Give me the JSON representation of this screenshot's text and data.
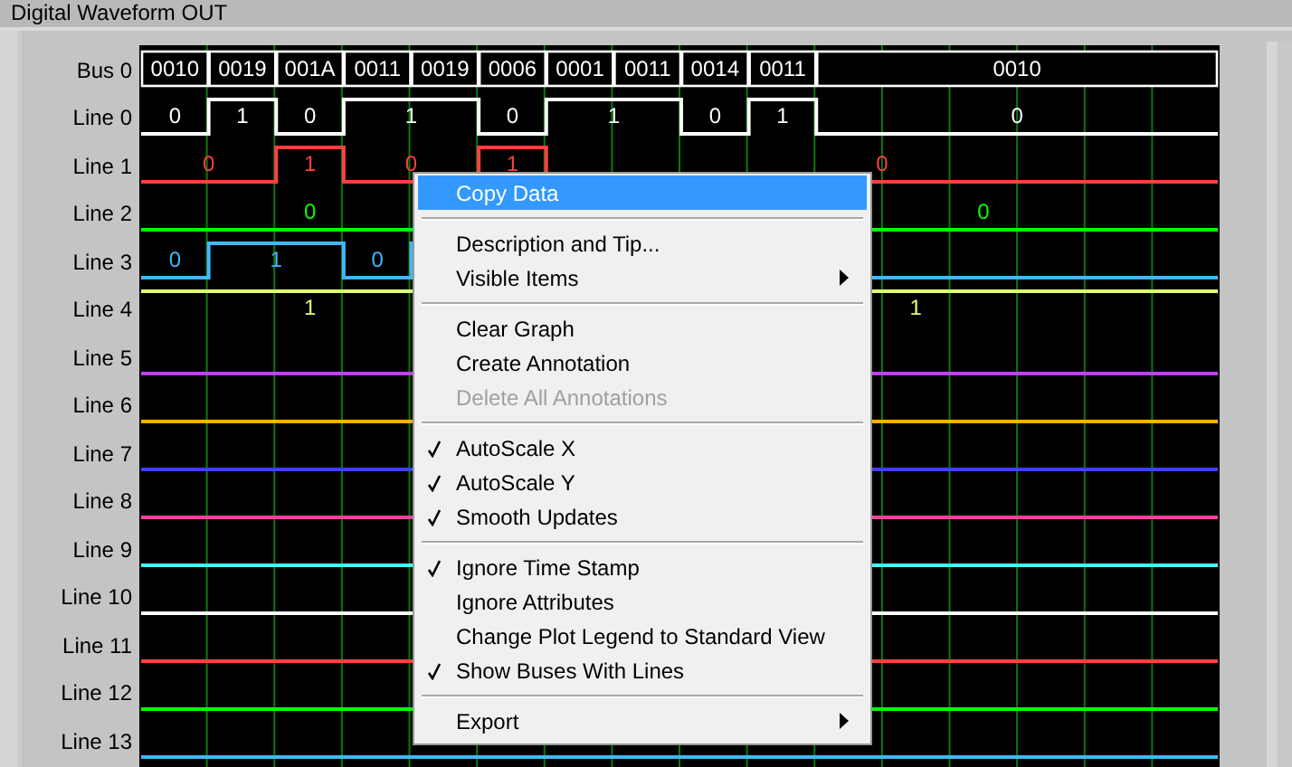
{
  "title": "Digital Waveform OUT",
  "bus": {
    "name": "Bus 0",
    "values": [
      "0010",
      "0019",
      "001A",
      "0011",
      "0019",
      "0006",
      "0001",
      "0011",
      "0014",
      "0011",
      "0010"
    ]
  },
  "lines": [
    {
      "name": "Line 0",
      "color": "#ffffff",
      "labels": [
        "0",
        "1",
        "0",
        "1",
        "0",
        "1",
        "0",
        "1",
        "0"
      ]
    },
    {
      "name": "Line 1",
      "color": "#ff4040",
      "labels": [
        "0",
        "1",
        "0",
        "1",
        "0"
      ]
    },
    {
      "name": "Line 2",
      "color": "#00ff00",
      "labels": [
        "0",
        "0"
      ]
    },
    {
      "name": "Line 3",
      "color": "#40b8ff",
      "labels": [
        "0",
        "1",
        "0"
      ]
    },
    {
      "name": "Line 4",
      "color": "#e0ff70",
      "labels": [
        "1",
        "1"
      ]
    },
    {
      "name": "Line 5",
      "color": "#c040ff"
    },
    {
      "name": "Line 6",
      "color": "#ffb000"
    },
    {
      "name": "Line 7",
      "color": "#4040ff"
    },
    {
      "name": "Line 8",
      "color": "#ff40a0"
    },
    {
      "name": "Line 9",
      "color": "#40ffff"
    },
    {
      "name": "Line 10",
      "color": "#ffffff"
    },
    {
      "name": "Line 11",
      "color": "#ff4040"
    },
    {
      "name": "Line 12",
      "color": "#00ff00"
    },
    {
      "name": "Line 13",
      "color": "#40b8ff"
    }
  ],
  "context_menu": [
    {
      "kind": "item",
      "label": "Copy Data",
      "selected": true,
      "checked": false,
      "disabled": false,
      "submenu": false
    },
    {
      "kind": "separator"
    },
    {
      "kind": "item",
      "label": "Description and Tip...",
      "selected": false,
      "checked": false,
      "disabled": false,
      "submenu": false
    },
    {
      "kind": "item",
      "label": "Visible Items",
      "selected": false,
      "checked": false,
      "disabled": false,
      "submenu": true
    },
    {
      "kind": "separator"
    },
    {
      "kind": "item",
      "label": "Clear Graph",
      "selected": false,
      "checked": false,
      "disabled": false,
      "submenu": false
    },
    {
      "kind": "item",
      "label": "Create Annotation",
      "selected": false,
      "checked": false,
      "disabled": false,
      "submenu": false
    },
    {
      "kind": "item",
      "label": "Delete All Annotations",
      "selected": false,
      "checked": false,
      "disabled": true,
      "submenu": false
    },
    {
      "kind": "separator"
    },
    {
      "kind": "item",
      "label": "AutoScale X",
      "selected": false,
      "checked": true,
      "disabled": false,
      "submenu": false
    },
    {
      "kind": "item",
      "label": "AutoScale Y",
      "selected": false,
      "checked": true,
      "disabled": false,
      "submenu": false
    },
    {
      "kind": "item",
      "label": "Smooth Updates",
      "selected": false,
      "checked": true,
      "disabled": false,
      "submenu": false
    },
    {
      "kind": "separator"
    },
    {
      "kind": "item",
      "label": "Ignore Time Stamp",
      "selected": false,
      "checked": true,
      "disabled": false,
      "submenu": false
    },
    {
      "kind": "item",
      "label": "Ignore Attributes",
      "selected": false,
      "checked": false,
      "disabled": false,
      "submenu": false
    },
    {
      "kind": "item",
      "label": "Change Plot Legend to Standard View",
      "selected": false,
      "checked": false,
      "disabled": false,
      "submenu": false
    },
    {
      "kind": "item",
      "label": "Show Buses With Lines",
      "selected": false,
      "checked": true,
      "disabled": false,
      "submenu": false
    },
    {
      "kind": "separator"
    },
    {
      "kind": "item",
      "label": "Export",
      "selected": false,
      "checked": false,
      "disabled": false,
      "submenu": true
    }
  ]
}
